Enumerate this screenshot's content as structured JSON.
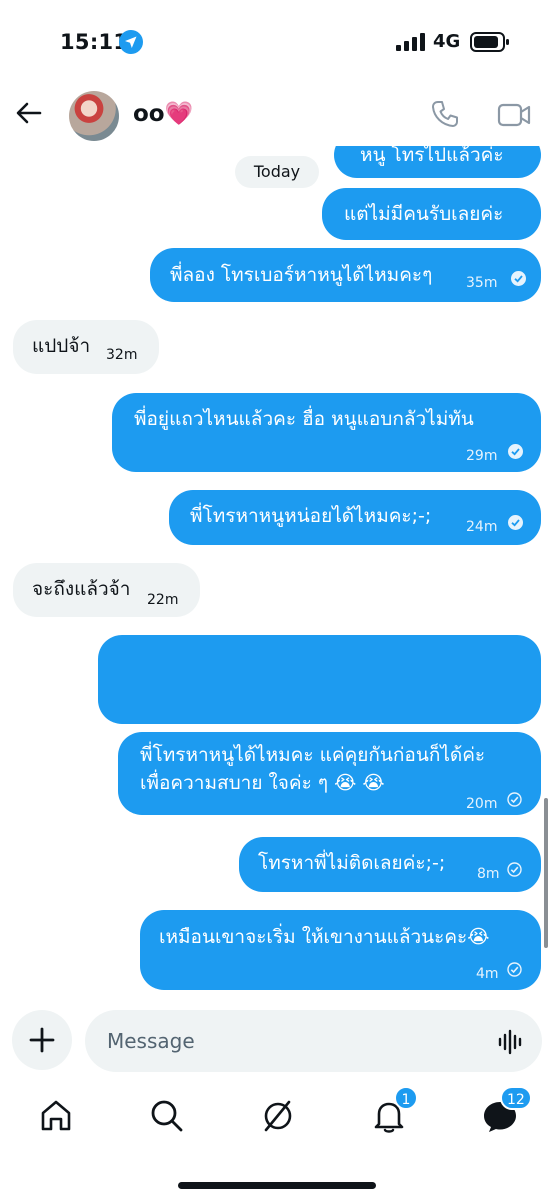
{
  "status_bar": {
    "time": "15:11",
    "network": "4G"
  },
  "header": {
    "contact_name": "oo💗"
  },
  "chat": {
    "date_label": "Today",
    "messages": [
      {
        "text": "หนู โทรไปแล้วค่ะ",
        "meta": ""
      },
      {
        "text": "แต่ไม่มีคนรับเลยค่ะ",
        "meta": ""
      },
      {
        "text": "พี่ลอง โทรเบอร์หาหนูได้ไหมคะๆ",
        "meta": "35m"
      },
      {
        "text": "แปปจ้า",
        "meta": "32m"
      },
      {
        "text": "พี่อยู่แถวไหนแล้วคะ ฮื่อ หนูแอบกลัวไม่ทัน",
        "meta": "29m"
      },
      {
        "text": "พี่โทรหาหนูหน่อยได้ไหมคะ;-;",
        "meta": "24m"
      },
      {
        "text": "จะถึงแล้วจ้า",
        "meta": "22m"
      },
      {
        "text": "",
        "meta": ""
      },
      {
        "text": "พี่โทรหาหนูได้ไหมคะ แค่คุยกันก่อนก็ได้ค่ะ",
        "text2": "เพื่อความสบาย ใจค่ะ ๆ 😭 😭",
        "meta": "20m"
      },
      {
        "text": "โทรหาพี่ไม่ติดเลยค่ะ;-;",
        "meta": "8m"
      },
      {
        "text": "เหมือนเขาจะเริ่ม ให้เขางานแล้วนะคะ😭",
        "meta": "4m"
      }
    ]
  },
  "composer": {
    "placeholder": "Message"
  },
  "tabbar": {
    "notifications_badge": "1",
    "messages_badge": "12"
  },
  "colors": {
    "accent": "#1d9bf0",
    "incoming_bubble": "#eff3f4",
    "text": "#0f1419"
  }
}
